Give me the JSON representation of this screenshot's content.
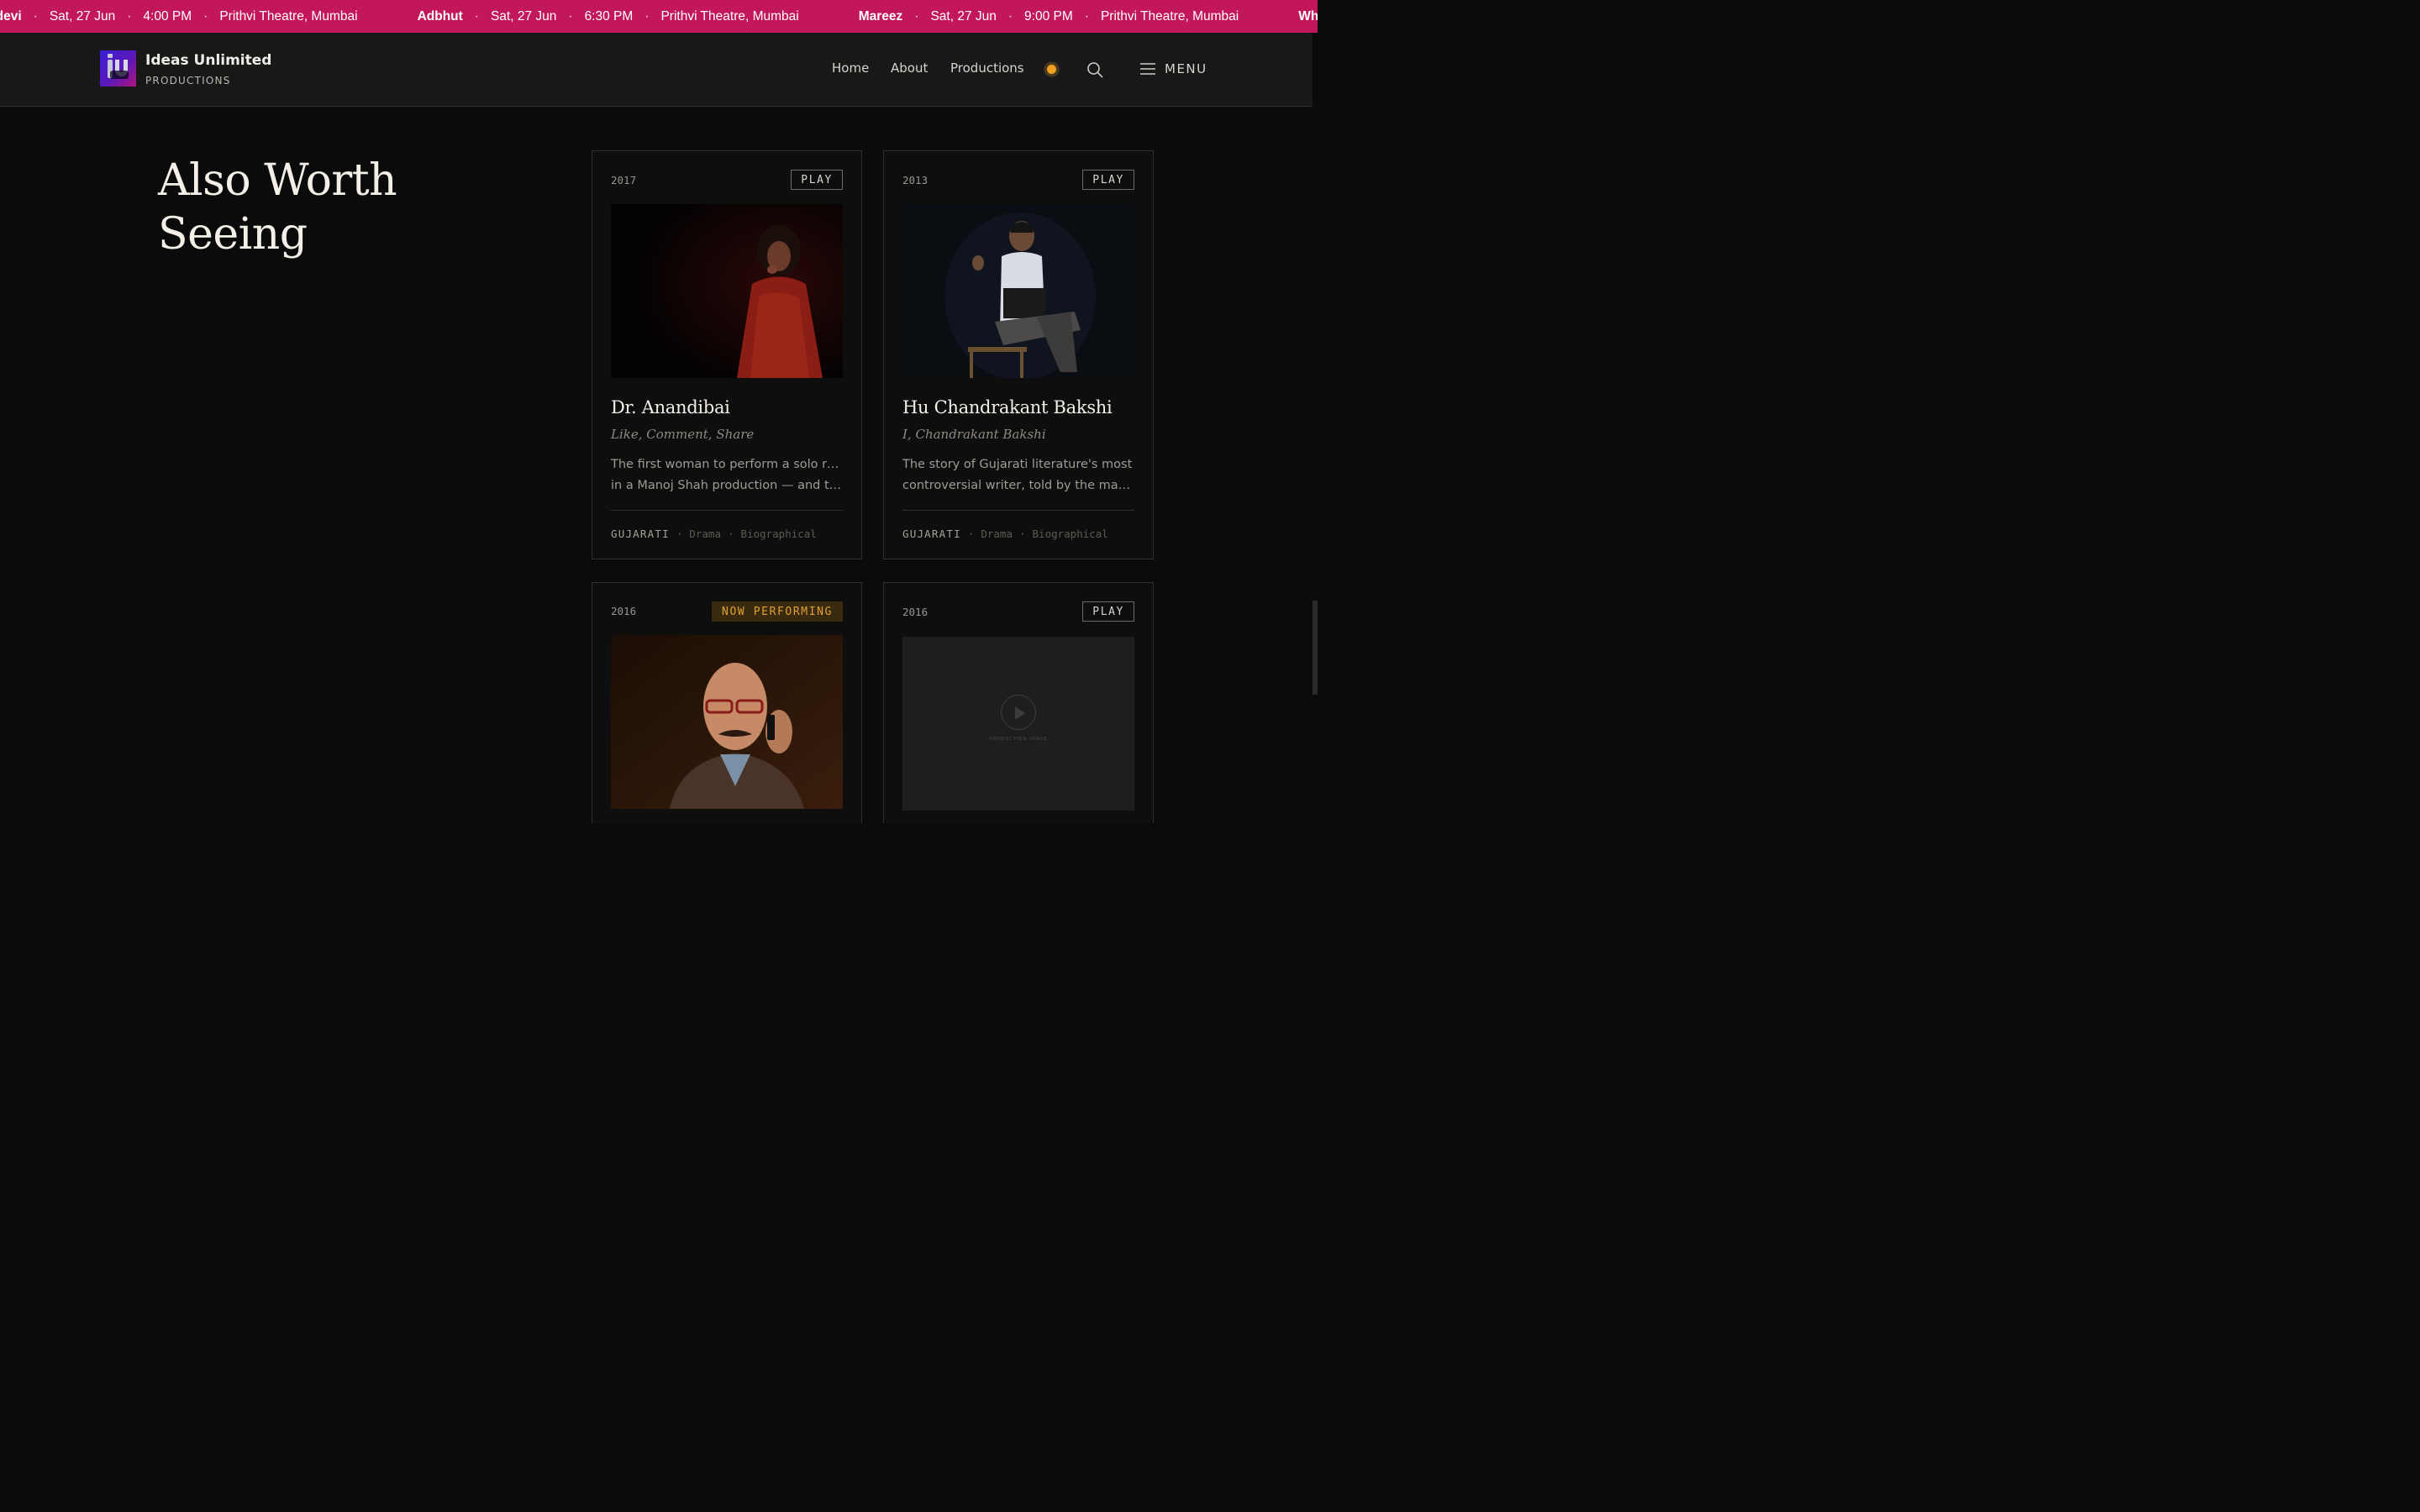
{
  "ticker": {
    "items": [
      {
        "title": "adevi",
        "date": "Sat, 27 Jun",
        "time": "4:00 PM",
        "venue": "Prithvi Theatre, Mumbai"
      },
      {
        "title": "Adbhut",
        "date": "Sat, 27 Jun",
        "time": "6:30 PM",
        "venue": "Prithvi Theatre, Mumbai"
      },
      {
        "title": "Mareez",
        "date": "Sat, 27 Jun",
        "time": "9:00 PM",
        "venue": "Prithvi Theatre, Mumbai"
      },
      {
        "title": "Wha",
        "date": "",
        "time": "",
        "venue": ""
      }
    ],
    "separator": "·"
  },
  "header": {
    "brand_name": "Ideas Unlimited",
    "brand_sub": "PRODUCTIONS",
    "nav": [
      "Home",
      "About",
      "Productions"
    ],
    "menu_label": "MENU"
  },
  "section": {
    "title_line1": "Also Worth",
    "title_line2": "Seeing"
  },
  "cards": [
    {
      "year": "2017",
      "badge": "PLAY",
      "title": "Dr. Anandibai",
      "subtitle": "Like, Comment, Share",
      "desc_line1": "The first woman to perform a solo role",
      "desc_line2": "in a Manoj Shah production — and th...",
      "language": "GUJARATI",
      "genre1": "Drama",
      "genre2": "Biographical"
    },
    {
      "year": "2013",
      "badge": "PLAY",
      "title": "Hu Chandrakant Bakshi",
      "subtitle": "I, Chandrakant Bakshi",
      "desc_line1": "The story of Gujarati literature's most",
      "desc_line2": "controversial writer, told by the man...",
      "language": "GUJARATI",
      "genre1": "Drama",
      "genre2": "Biographical"
    },
    {
      "year": "2016",
      "badge": "NOW PERFORMING"
    },
    {
      "year": "2016",
      "badge": "PLAY",
      "placeholder_label": "PRODUCTION IMAGE"
    }
  ],
  "colors": {
    "ticker_bg": "#c2185b",
    "header_bg": "#181818",
    "page_bg": "#0b0b0b",
    "accent_amber": "#e0a030"
  }
}
